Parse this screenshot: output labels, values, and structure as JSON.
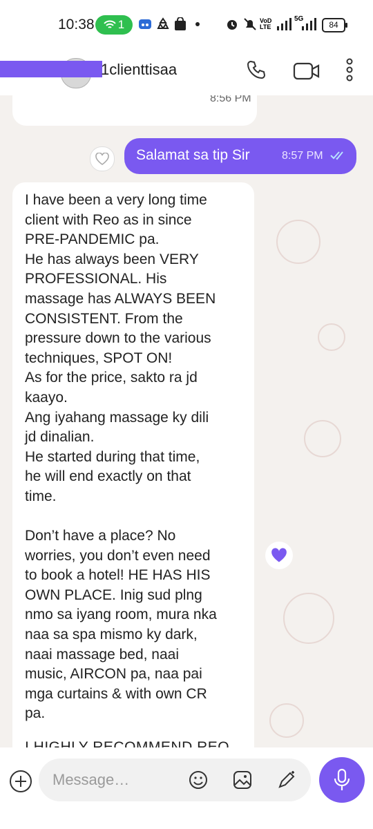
{
  "status_bar": {
    "time": "10:38",
    "hotspot_count": "1",
    "network": "5G",
    "volte": "VoD LTE",
    "battery": "84"
  },
  "header": {
    "contact_name": "1clienttisaa"
  },
  "messages": [
    {
      "direction": "in",
      "text": "",
      "time": "8:56 PM"
    },
    {
      "direction": "out",
      "text": "Salamat sa tip Sir",
      "time": "8:57 PM",
      "status": "read"
    },
    {
      "direction": "in",
      "text": "I have been a very long time\nclient with Reo as in since\nPRE-PANDEMIC pa.\nHe has always been VERY\nPROFESSIONAL. His\nmassage has ALWAYS BEEN\nCONSISTENT. From the\npressure down to the various\ntechniques, SPOT ON!\nAs for the price, sakto ra jd\nkaayo.\nAng iyahang massage ky dili\njd dinalian.\nHe started during that time,\nhe will end exactly on that\ntime.\n\nDon’t have a place? No\nworries, you don’t even need\nto book a hotel! HE HAS HIS\nOWN PLACE. Inig sud plng\nnmo sa iyang room, mura nka\nnaa sa spa mismo ky dark,\nnaai massage bed, naai\nmusic, AIRCON pa, naa pai\nmga curtains & with own CR\npa.",
      "cut_off_line": "I HIGHLY RECOMMEND REO"
    }
  ],
  "input": {
    "placeholder": "Message…"
  },
  "colors": {
    "accent": "#7a59f0",
    "background": "#f4f1ee",
    "bubble_in": "#ffffff"
  },
  "icons": [
    "call-icon",
    "video-icon",
    "more-icon",
    "like-heart-icon",
    "add-icon",
    "emoji-icon",
    "image-sticker-icon",
    "magic-pen-icon",
    "mic-icon"
  ]
}
